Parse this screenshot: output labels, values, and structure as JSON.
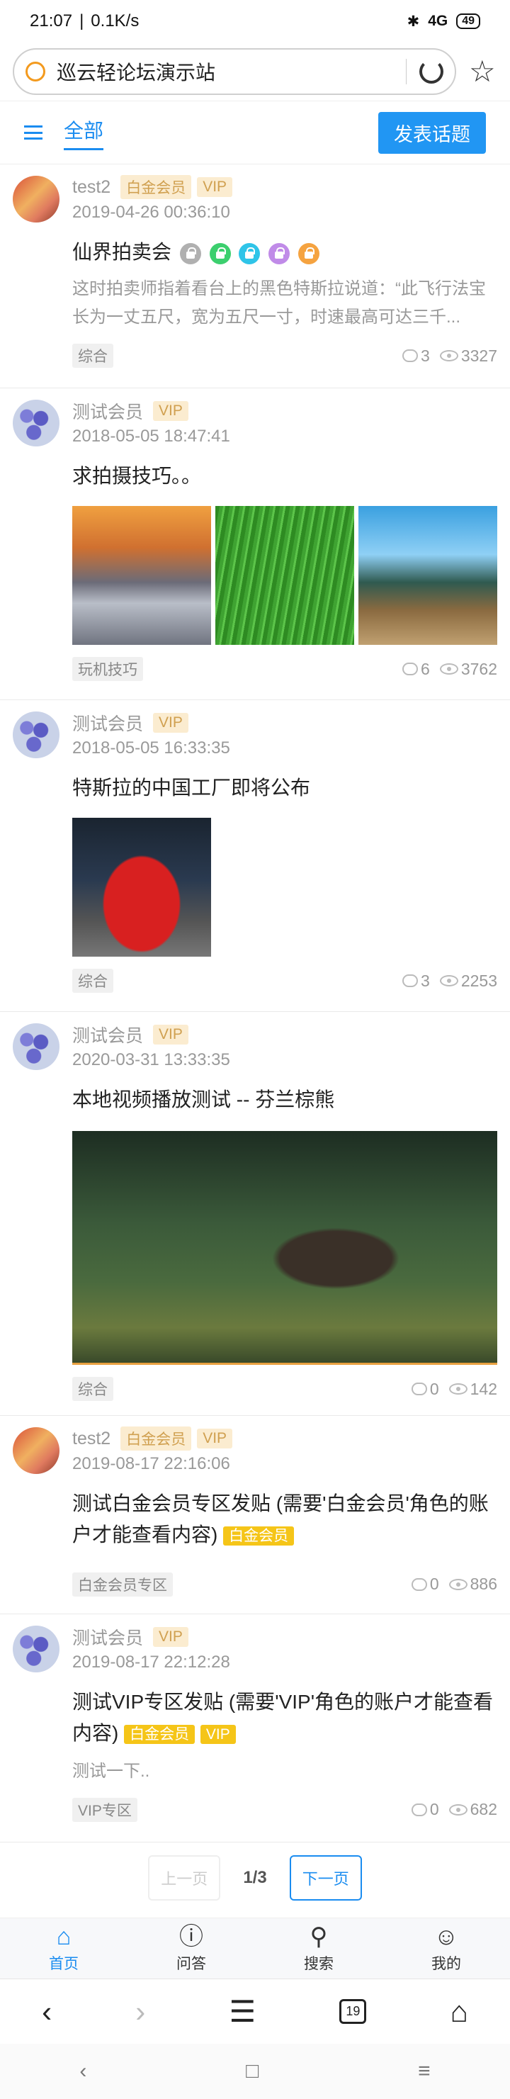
{
  "status_bar": {
    "time": "21:07",
    "speed": "0.1K/s",
    "network": "4G",
    "battery": "49"
  },
  "address_bar": {
    "site_title": "巡云轻论坛演示站"
  },
  "forum_header": {
    "tab_label": "全部",
    "new_topic_label": "发表话题"
  },
  "posts": [
    {
      "author": "test2",
      "badges": [
        "白金会员",
        "VIP"
      ],
      "date": "2019-04-26 00:36:10",
      "title": "仙界拍卖会",
      "excerpt": "这时拍卖师指着看台上的黑色特斯拉说道：“此飞行法宝长为一丈五尺，宽为五尺一寸，时速最高可达三千...",
      "tag": "综合",
      "comments": "3",
      "views": "3327"
    },
    {
      "author": "测试会员",
      "badges": [
        "VIP"
      ],
      "date": "2018-05-05 18:47:41",
      "title": "求拍摄技巧。。",
      "tag": "玩机技巧",
      "comments": "6",
      "views": "3762"
    },
    {
      "author": "测试会员",
      "badges": [
        "VIP"
      ],
      "date": "2018-05-05 16:33:35",
      "title": "特斯拉的中国工厂即将公布",
      "tag": "综合",
      "comments": "3",
      "views": "2253"
    },
    {
      "author": "测试会员",
      "badges": [
        "VIP"
      ],
      "date": "2020-03-31 13:33:35",
      "title": "本地视频播放测试 -- 芬兰棕熊",
      "tag": "综合",
      "comments": "0",
      "views": "142"
    },
    {
      "author": "test2",
      "badges": [
        "白金会员",
        "VIP"
      ],
      "date": "2019-08-17 22:16:06",
      "title": "测试白金会员专区发贴 (需要'白金会员'角色的账户才能查看内容)",
      "title_badges": [
        "白金会员"
      ],
      "tag": "白金会员专区",
      "comments": "0",
      "views": "886"
    },
    {
      "author": "测试会员",
      "badges": [
        "VIP"
      ],
      "date": "2019-08-17 22:12:28",
      "title": "测试VIP专区发贴 (需要'VIP'角色的账户才能查看内容)",
      "title_badges": [
        "白金会员",
        "VIP"
      ],
      "excerpt": "测试一下..",
      "tag": "VIP专区",
      "comments": "0",
      "views": "682"
    }
  ],
  "pagination": {
    "prev_label": "上一页",
    "page_indicator": "1/3",
    "next_label": "下一页"
  },
  "tabbar": {
    "home": "首页",
    "qa": "问答",
    "search": "搜索",
    "me": "我的"
  },
  "browser_nav": {
    "tabs_count": "19"
  },
  "colors": {
    "accent": "#1a8cf0",
    "badge_bg": "#fbecd0",
    "badge_text": "#d0a050",
    "title_badge_bg": "#f5c518",
    "lock_gray": "#b0b0b0",
    "lock_green": "#3ccf6e",
    "lock_cyan": "#2fc4e8",
    "lock_purple": "#c08be8",
    "lock_orange": "#f5a340"
  }
}
